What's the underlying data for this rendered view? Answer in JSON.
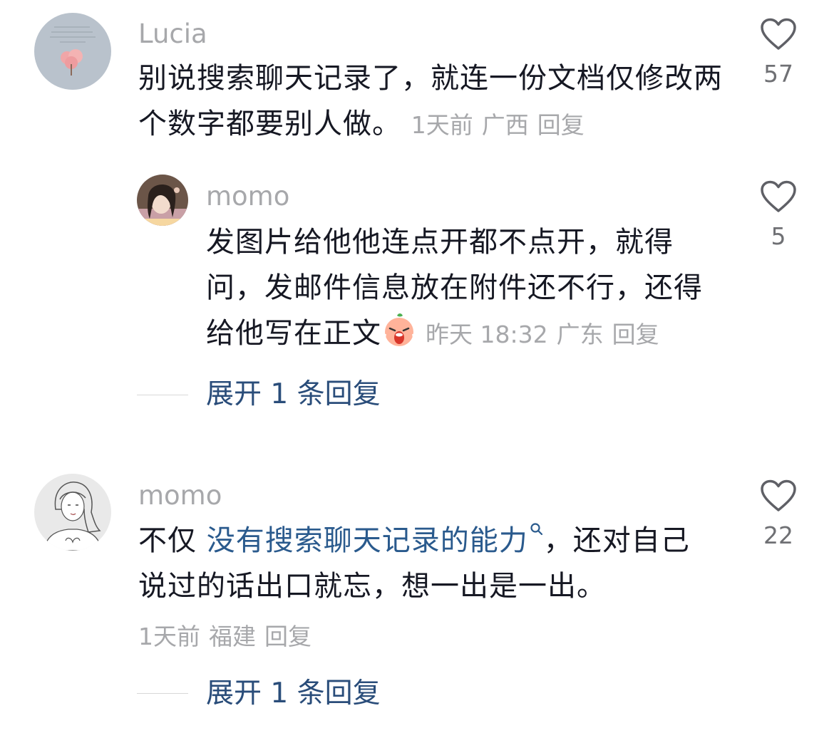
{
  "comments": [
    {
      "username": "Lucia",
      "text": "别说搜索聊天记录了，就连一份文档仅修改两个数字都要别人做。",
      "time": "1天前",
      "location": "广西",
      "reply_label": "回复",
      "likes": "57",
      "replies": [
        {
          "username": "momo",
          "text": "发图片给他他连点开都不点开，就得问，发邮件信息放在附件还不行，还得给他写在正文",
          "emoji": "crying-face-emoji",
          "time": "昨天 18:32",
          "location": "广东",
          "reply_label": "回复",
          "likes": "5"
        }
      ],
      "expand_label": "展开 1 条回复"
    },
    {
      "username": "momo",
      "text_before": "不仅 ",
      "highlight": "没有搜索聊天记录的能力",
      "text_after": "，还对自己说过的话出口就忘，想一出是一出。",
      "time": "1天前",
      "location": "福建",
      "reply_label": "回复",
      "likes": "22",
      "expand_label": "展开 1 条回复"
    }
  ],
  "icons": {
    "like": "heart-outline-icon",
    "search_hint": "search-icon"
  },
  "colors": {
    "username": "#a7a8ab",
    "text": "#161823",
    "link": "#2a4d7a",
    "meta": "#a7a8ab"
  }
}
